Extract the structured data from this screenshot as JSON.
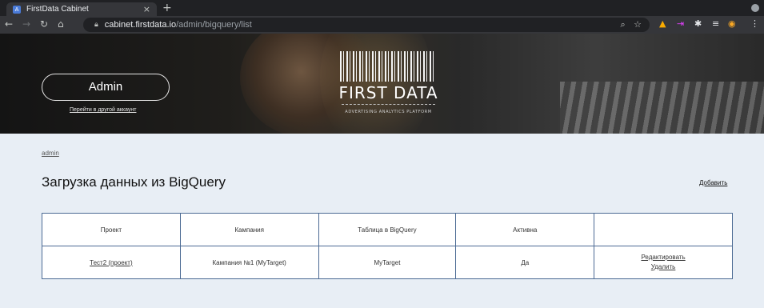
{
  "browser": {
    "tab_title": "FirstData Cabinet",
    "tab_favicon": "A",
    "tab_close": "×",
    "new_tab": "+",
    "url_host": "cabinet.firstdata.io",
    "url_path": "/admin/bigquery/list",
    "icons": [
      "back-icon",
      "forward-icon",
      "reload-icon",
      "home-icon",
      "lock-icon",
      "zoom-icon",
      "star-icon",
      "extensions-icon",
      "reading-list-icon",
      "profile-icon",
      "menu-icon"
    ]
  },
  "hero": {
    "admin_label": "Admin",
    "switch_account": "Перейти в другой аккаунт",
    "logo_text": "FIRST DATA",
    "logo_sub": "ADVERTISING ANALYTICS PLATFORM"
  },
  "content": {
    "breadcrumb": "admin",
    "title": "Загрузка данных из BigQuery",
    "add_label": "Добавить"
  },
  "table": {
    "headers": [
      "Проект",
      "Кампания",
      "Таблица в BigQuery",
      "Активна",
      ""
    ],
    "rows": [
      {
        "project": "Тест2 (проект)",
        "campaign": "Кампания №1 (MyTarget)",
        "bq_table": "MyTarget",
        "active": "Да",
        "edit": "Редактировать",
        "delete": "Удалить"
      }
    ]
  },
  "colors": {
    "accent_border": "#4b6a94",
    "page_bg": "#e8eef5"
  }
}
